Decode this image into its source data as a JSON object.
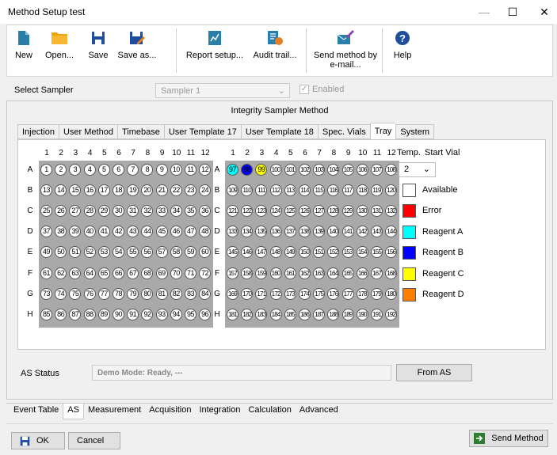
{
  "window": {
    "title": "Method Setup test",
    "minimize": "—",
    "maximize": "☐",
    "close": "✕"
  },
  "toolbar": [
    {
      "label": "New",
      "icon": "new-document-icon"
    },
    {
      "label": "Open...",
      "icon": "folder-icon"
    },
    {
      "label": "Save",
      "icon": "save-icon"
    },
    {
      "label": "Save as...",
      "icon": "save-as-icon"
    },
    {
      "label": "Report setup...",
      "icon": "report-icon"
    },
    {
      "label": "Audit trail...",
      "icon": "audit-icon"
    },
    {
      "label": "Send method by\ne-mail...",
      "icon": "email-icon"
    },
    {
      "label": "Help",
      "icon": "help-icon"
    }
  ],
  "sampler": {
    "label": "Select Sampler",
    "value": "Sampler 1",
    "enabled_label": "Enabled",
    "enabled": true
  },
  "panel_title": "Integrity Sampler Method",
  "tabs": [
    "Injection",
    "User Method",
    "Timebase",
    "User Template 17",
    "User Template 18",
    "Spec. Vials",
    "Tray",
    "System"
  ],
  "active_tab": "Tray",
  "tray": {
    "column_numbers": [
      "1",
      "2",
      "3",
      "4",
      "5",
      "6",
      "7",
      "8",
      "9",
      "10",
      "11",
      "12"
    ],
    "row_letters": [
      "A",
      "B",
      "C",
      "D",
      "E",
      "F",
      "G",
      "H"
    ],
    "plate1_start": 1,
    "plate2_start": 97,
    "vial_colors": {
      "97": "#00ffff",
      "98": "#0000ff",
      "99": "#ffff00"
    },
    "temp_label": "Temp.",
    "start_vial_label": "Start Vial",
    "start_vial_value": "2",
    "legend": [
      {
        "label": "Available",
        "color": "#ffffff"
      },
      {
        "label": "Error",
        "color": "#ff0000"
      },
      {
        "label": "Reagent A",
        "color": "#00ffff"
      },
      {
        "label": "Reagent B",
        "color": "#0000ff"
      },
      {
        "label": "Reagent C",
        "color": "#ffff00"
      },
      {
        "label": "Reagent D",
        "color": "#ff8000"
      }
    ]
  },
  "status": {
    "label": "AS Status",
    "value": "Demo Mode: Ready, ---",
    "button": "From AS"
  },
  "bottom_tabs": [
    "Event Table",
    "AS",
    "Measurement",
    "Acquisition",
    "Integration",
    "Calculation",
    "Advanced"
  ],
  "active_bottom_tab": "AS",
  "footer": {
    "ok": "OK",
    "cancel": "Cancel",
    "send": "Send Method"
  }
}
